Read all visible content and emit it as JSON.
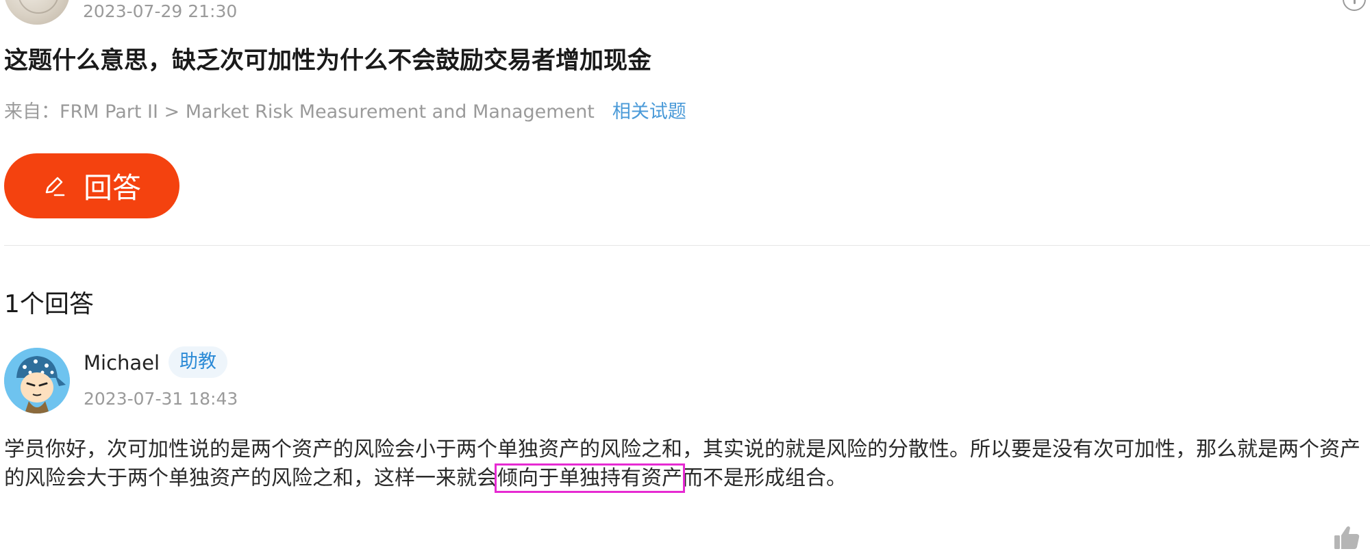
{
  "question": {
    "date": "2023-07-29 21:30",
    "title": "这题什么意思，缺乏次可加性为什么不会鼓励交易者增加现金",
    "source_prefix": "来自：",
    "source_path": "FRM Part II > Market Risk Measurement and Management",
    "related_link": "相关试题"
  },
  "answer_button": {
    "label": "回答"
  },
  "answers_section": {
    "count_label": "1个回答"
  },
  "reply": {
    "author": "Michael",
    "role": "助教",
    "date": "2023-07-31 18:43",
    "body_before": "学员你好，次可加性说的是两个资产的风险会小于两个单独资产的风险之和，其实说的就是风险的分散性。所以要是没有次可加性，那么就是两个资产的风险会大于两个单独资产的风险之和，这样一来就会",
    "body_highlight": "倾向于单独持有资产",
    "body_after": "而不是形成组合。"
  },
  "colors": {
    "accent": "#f4420f",
    "link": "#4a9ad8",
    "badge_text": "#2b8ad6",
    "highlight_box": "#e62ad2"
  },
  "icons": [
    "more-icon",
    "pen-icon",
    "like-icon"
  ]
}
